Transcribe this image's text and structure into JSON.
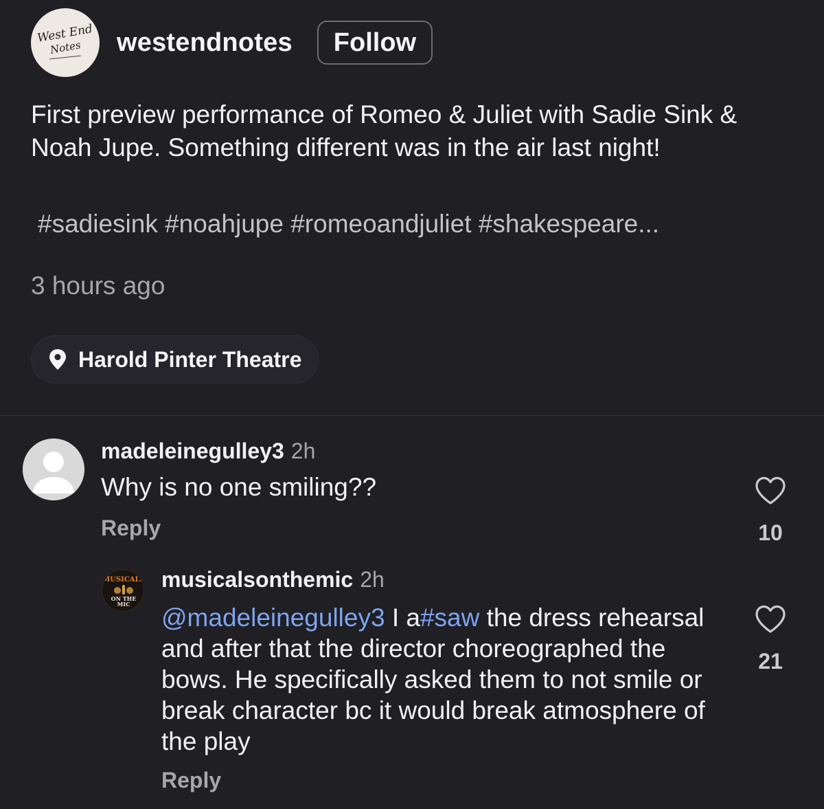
{
  "post": {
    "username": "westendnotes",
    "avatar_logo_line1": "West End",
    "avatar_logo_line2": "Notes",
    "follow_label": "Follow",
    "caption": "First preview performance of Romeo & Juliet with Sadie Sink & Noah Jupe. Something different was in the air last night!",
    "hashtags": "#sadiesink #noahjupe #romeoandjuliet #shakespeare...",
    "timestamp": "3 hours ago",
    "location": "Harold Pinter Theatre",
    "location_icon": "map-pin-icon"
  },
  "comments": [
    {
      "username": "madeleinegulley3",
      "time": "2h",
      "text": "Why is no one smiling??",
      "reply_label": "Reply",
      "likes": "10",
      "avatar_icon": "default-user-icon",
      "like_icon": "heart-outline-icon"
    },
    {
      "username": "musicalsonthemic",
      "time": "2h",
      "mention": "@madeleinegulley3",
      "text_part1": " I a",
      "hashtag": "#saw",
      "text_part2": " the dress rehearsal and after that the director choreographed the bows. He specifically asked them to not smile or break character bc it would break atmosphere of the play",
      "reply_label": "Reply",
      "likes": "21",
      "avatar_logo_top": "MUSICALS",
      "avatar_logo_bottom1": "ON THE",
      "avatar_logo_bottom2": "MIC",
      "like_icon": "heart-outline-icon"
    }
  ],
  "colors": {
    "background": "#1f1f24",
    "text_primary": "#f2f2f4",
    "text_secondary": "#a6a6ac",
    "link": "#7fa4ee"
  }
}
